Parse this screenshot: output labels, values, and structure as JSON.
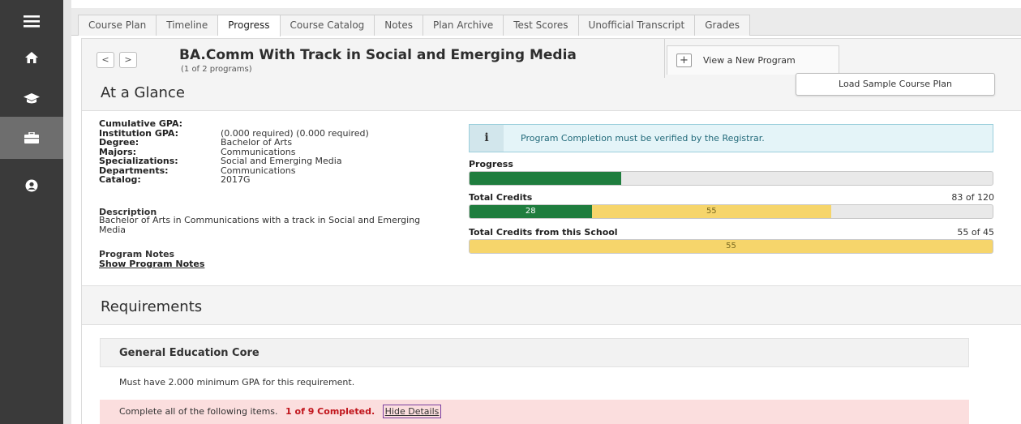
{
  "tabs": [
    "Course Plan",
    "Timeline",
    "Progress",
    "Course Catalog",
    "Notes",
    "Plan Archive",
    "Test Scores",
    "Unofficial Transcript",
    "Grades"
  ],
  "active_tab": "Progress",
  "program": {
    "prev_label": "<",
    "next_label": ">",
    "title": "BA.Comm With Track in Social and Emerging Media",
    "count": "(1 of 2 programs)",
    "new_plus": "+",
    "new_label": "View a New Program"
  },
  "glance": {
    "title": "At a Glance",
    "load_button": "Load Sample Course Plan",
    "info": [
      {
        "label": "Cumulative GPA:",
        "value": ""
      },
      {
        "label": "Institution GPA:",
        "value": "(0.000 required) (0.000 required)"
      },
      {
        "label": "Degree:",
        "value": "Bachelor of Arts"
      },
      {
        "label": "Majors:",
        "value": "Communications"
      },
      {
        "label": "Specializations:",
        "value": "Social and Emerging Media"
      },
      {
        "label": "Departments:",
        "value": "Communications"
      },
      {
        "label": "Catalog:",
        "value": "2017G"
      }
    ],
    "description_label": "Description",
    "description": "Bachelor of Arts in Communications with a track in Social and Emerging Media",
    "notes_label": "Program Notes",
    "notes_link": "Show Program Notes",
    "alert_icon": "i",
    "alert_text": "Program Completion must be verified by the Registrar.",
    "progress_label": "Progress",
    "progress_fraction": 0.29,
    "total_credits_label": "Total Credits",
    "total_credits_count": "83 of 120",
    "total_credits_completed": "28",
    "total_credits_in_progress": "55",
    "total_credits_max": 120,
    "school_credits_label": "Total Credits from this School",
    "school_credits_count": "55 of 45",
    "school_credits_value": "55"
  },
  "requirements": {
    "title": "Requirements",
    "core_title": "General Education Core",
    "gpa_note": "Must have 2.000 minimum GPA for this requirement.",
    "complete_text": "Complete all of the following items.",
    "complete_count": "1 of 9 Completed.",
    "hide_details": "Hide Details"
  },
  "colors": {
    "rail": "#3a3a3a",
    "completed": "#1f7d3e",
    "in_progress": "#f6d56b",
    "incomplete_row": "#fbdede",
    "alert": "#e4f4f8"
  },
  "icons": [
    "menu-icon",
    "home-icon",
    "graduation-cap-icon",
    "briefcase-icon",
    "user-circle-icon"
  ]
}
